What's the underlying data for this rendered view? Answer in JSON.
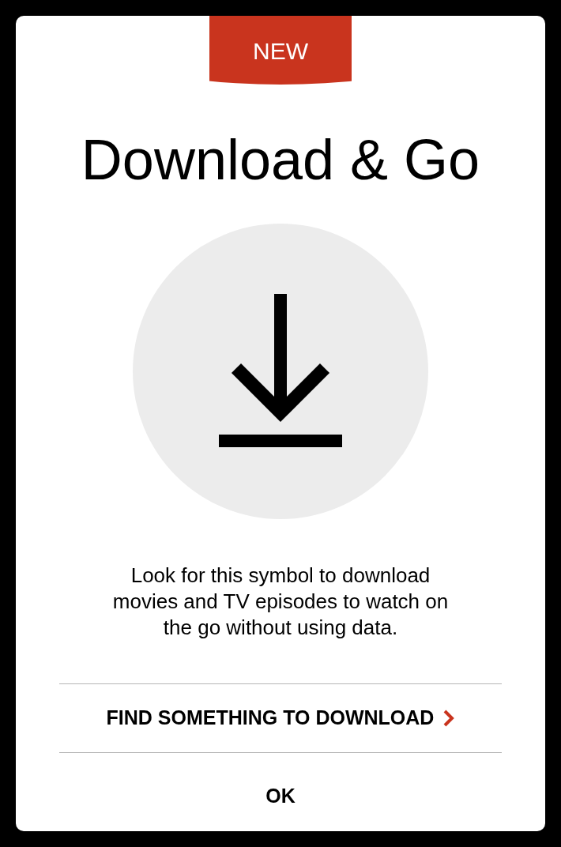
{
  "badge": "NEW",
  "title": "Download & Go",
  "description": "Look for this symbol to download movies and TV episodes to watch on the go without using data.",
  "actions": [
    {
      "label": "FIND SOMETHING TO DOWNLOAD",
      "kind": "link"
    },
    {
      "label": "OK",
      "kind": "plain"
    }
  ]
}
